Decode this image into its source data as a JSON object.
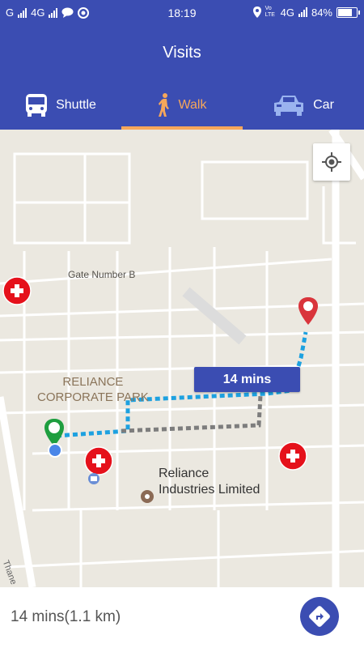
{
  "status_bar": {
    "carrier_1": "G",
    "carrier_2": "4G",
    "time": "18:19",
    "network_label": "Vo LTE",
    "network_type": "4G",
    "battery_percent": "84%",
    "battery_level": 0.84
  },
  "app_bar": {
    "title": "Visits"
  },
  "tabs": [
    {
      "label": "Shuttle",
      "icon": "bus-icon",
      "active": false
    },
    {
      "label": "Walk",
      "icon": "walking-person-icon",
      "active": true
    },
    {
      "label": "Car",
      "icon": "car-icon",
      "active": false
    }
  ],
  "map": {
    "labels": {
      "gate": "Gate Number B",
      "park_line1": "RELIANCE",
      "park_line2": "CORPORATE PARK",
      "industries_line1": "Reliance",
      "industries_line2": "Industries Limited",
      "road": "Thane"
    },
    "route_time_badge": "14 mins",
    "icons": {
      "locate": "my-location-icon",
      "start_pin": "origin-pin-icon",
      "end_pin": "destination-pin-icon",
      "current_location": "current-location-dot",
      "hospital": "hospital-icon",
      "poi": "place-icon"
    },
    "colors": {
      "walk_route": "#1da1e0",
      "alt_route": "#7d7d7d",
      "start_pin": "#1e9e3f",
      "end_pin": "#d9343b",
      "hospital": "#e5111b"
    }
  },
  "bottom_bar": {
    "summary": "14 mins(1.1 km)",
    "navigate_icon": "directions-icon"
  },
  "colors": {
    "primary": "#3b4db2",
    "accent": "#f6a75b"
  }
}
